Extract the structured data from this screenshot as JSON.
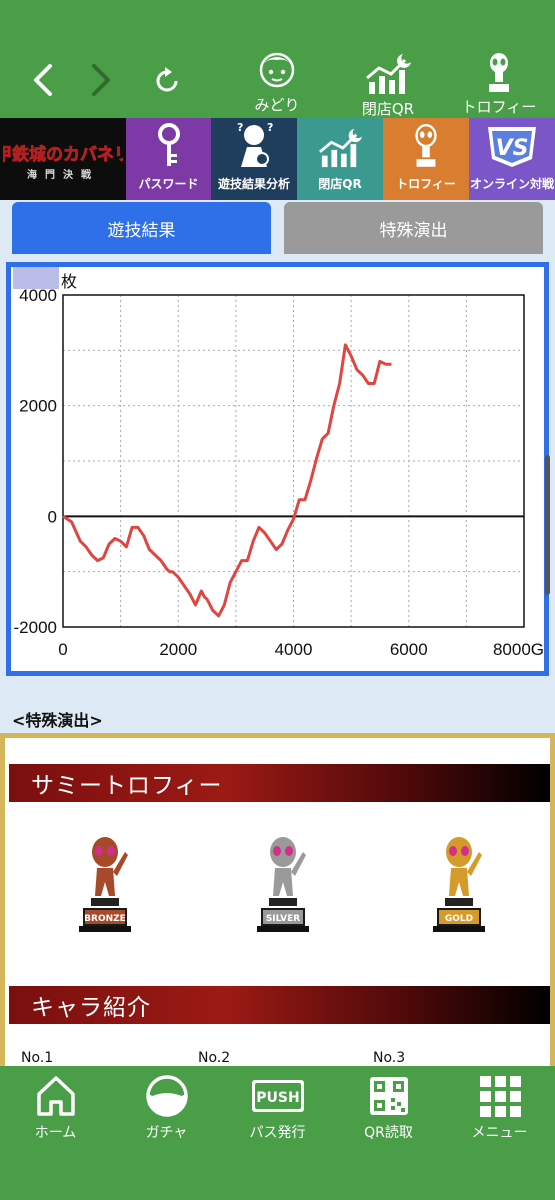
{
  "topnav": {
    "back_icon": "chevron-left-icon",
    "forward_icon": "chevron-right-icon",
    "reload_icon": "reload-icon",
    "items": [
      {
        "label": "みどり",
        "icon": "character-midori-icon"
      },
      {
        "label": "閉店QR",
        "icon": "chart-moon-icon"
      },
      {
        "label": "トロフィー",
        "icon": "trophy-icon"
      }
    ]
  },
  "menu": {
    "logo_text": "甲鉄城のカバネリ",
    "logo_subtext": "海門決戦",
    "items": [
      {
        "label": "パスワード",
        "color": "#7d3aa7"
      },
      {
        "label": "遊技結果分析",
        "color": "#1f3d5c"
      },
      {
        "label": "閉店QR",
        "color": "#3a9a90"
      },
      {
        "label": "トロフィー",
        "color": "#d97d30"
      },
      {
        "label": "オンライン対戦",
        "color": "#7a56c8"
      }
    ]
  },
  "tabs": {
    "active": "遊技結果",
    "inactive": "特殊演出"
  },
  "chart_data": {
    "type": "line",
    "title": "",
    "ylabel": "枚",
    "xlabel": "",
    "xlim": [
      0,
      8000
    ],
    "ylim": [
      -2000,
      4000
    ],
    "x_ticks": [
      "0",
      "2000",
      "4000",
      "6000",
      "8000G"
    ],
    "y_ticks": [
      "4000",
      "2000",
      "0",
      "-2000"
    ],
    "grid": true,
    "series": [
      {
        "color": "#e0463f",
        "x": [
          0,
          150,
          300,
          400,
          500,
          600,
          700,
          800,
          900,
          1000,
          1100,
          1200,
          1300,
          1400,
          1500,
          1600,
          1700,
          1800,
          1850,
          1900,
          2000,
          2100,
          2200,
          2300,
          2400,
          2450,
          2500,
          2600,
          2700,
          2800,
          2900,
          3000,
          3100,
          3200,
          3300,
          3400,
          3500,
          3600,
          3700,
          3800,
          3900,
          4000,
          4100,
          4200,
          4300,
          4400,
          4500,
          4600,
          4700,
          4800,
          4900,
          5000,
          5100,
          5200,
          5300,
          5400,
          5500,
          5600,
          5700
        ],
        "y": [
          0,
          -100,
          -450,
          -550,
          -700,
          -800,
          -750,
          -500,
          -400,
          -450,
          -550,
          -200,
          -200,
          -350,
          -600,
          -700,
          -800,
          -950,
          -1000,
          -1000,
          -1100,
          -1250,
          -1400,
          -1600,
          -1350,
          -1450,
          -1500,
          -1700,
          -1800,
          -1600,
          -1200,
          -1000,
          -800,
          -800,
          -450,
          -200,
          -300,
          -450,
          -600,
          -500,
          -250,
          -50,
          300,
          300,
          650,
          1050,
          1400,
          1500,
          2000,
          2400,
          3100,
          2900,
          2650,
          2550,
          2400,
          2400,
          2800,
          2750,
          2750
        ]
      }
    ]
  },
  "section_title": "<特殊演出>",
  "special": {
    "trophy_banner": "サミートロフィー",
    "trophies": [
      {
        "label": "BRONZE",
        "color": "#a64a2a"
      },
      {
        "label": "SILVER",
        "color": "#9a9a9a"
      },
      {
        "label": "GOLD",
        "color": "#d69a2a"
      }
    ],
    "chara_banner": "キャラ紹介",
    "numbers": [
      "No.1",
      "No.2",
      "No.3"
    ]
  },
  "bottomnav": {
    "items": [
      {
        "label": "ホーム",
        "icon": "home-icon"
      },
      {
        "label": "ガチャ",
        "icon": "gacha-ball-icon"
      },
      {
        "label": "パス発行",
        "icon": "push-icon",
        "push_text": "PUSH"
      },
      {
        "label": "QR読取",
        "icon": "qr-code-icon"
      },
      {
        "label": "メニュー",
        "icon": "grid-menu-icon"
      }
    ]
  }
}
